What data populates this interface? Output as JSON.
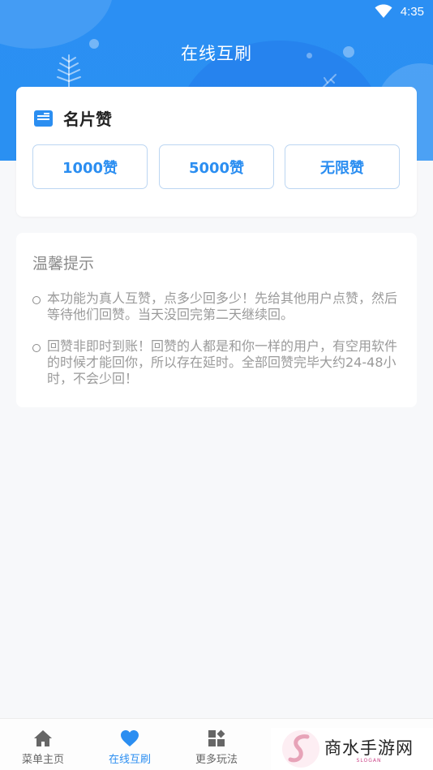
{
  "status_bar": {
    "time": "4:35",
    "wifi_icon": "wifi-icon"
  },
  "header": {
    "title": "在线互刷"
  },
  "likes_card": {
    "title": "名片赞",
    "icon": "card-icon",
    "buttons": [
      {
        "label": "1000赞"
      },
      {
        "label": "5000赞"
      },
      {
        "label": "无限赞"
      }
    ]
  },
  "tips_card": {
    "heading": "温馨提示",
    "items": [
      {
        "text": "本功能为真人互赞，点多少回多少！先给其他用户点赞，然后等待他们回赞。当天没回完第二天继续回。"
      },
      {
        "text": "回赞非即时到账！回赞的人都是和你一样的用户，有空用软件的时候才能回你，所以存在延时。全部回赞完毕大约24-48小时，不会少回！"
      }
    ]
  },
  "bottom_nav": {
    "items": [
      {
        "label": "菜单主页",
        "icon": "home-icon",
        "active": false
      },
      {
        "label": "在线互刷",
        "icon": "heart-icon",
        "active": true
      },
      {
        "label": "更多玩法",
        "icon": "grid-icon",
        "active": false
      }
    ]
  },
  "watermark": {
    "text": "商水手游网",
    "sub": "SLOGAN"
  },
  "colors": {
    "accent": "#2b8ef1",
    "header_bg": "#2b8ff3",
    "page_bg": "#f7f8fa"
  }
}
